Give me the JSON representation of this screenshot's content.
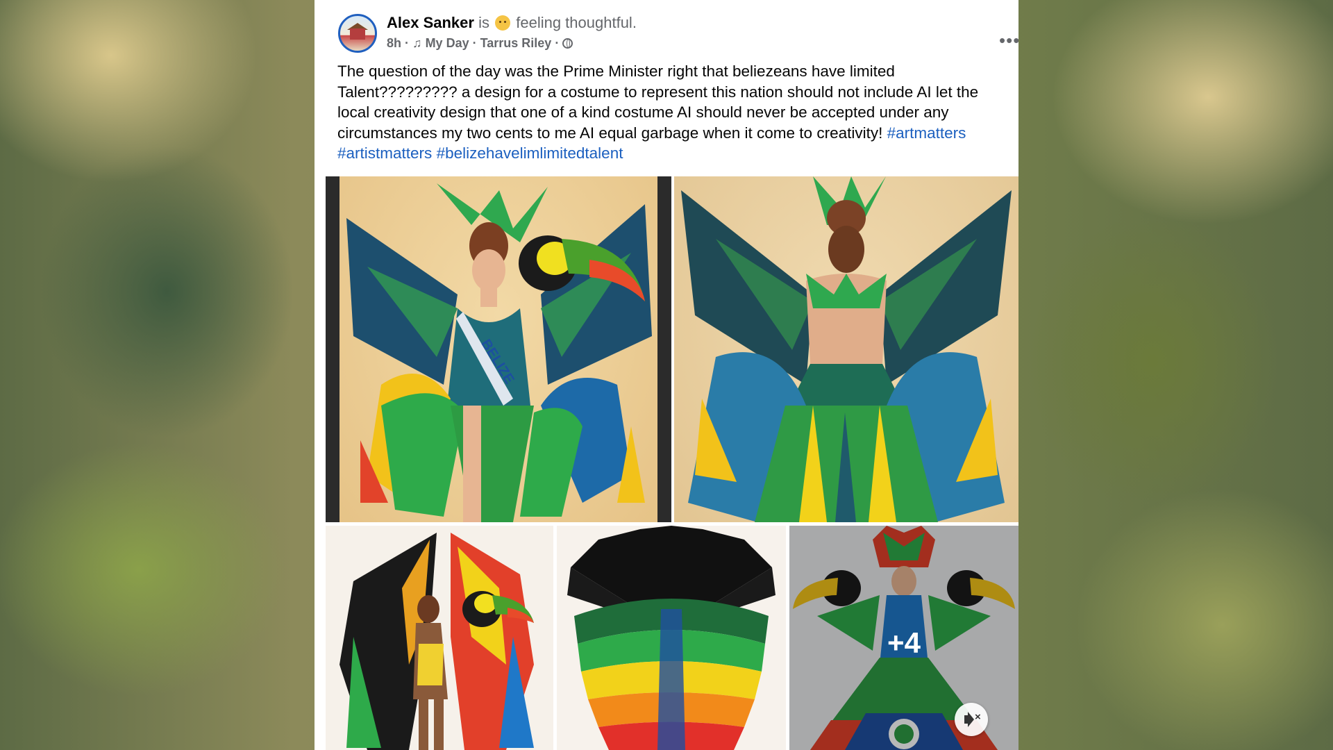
{
  "post": {
    "author": "Alex Sanker",
    "activity_prefix": "is",
    "feeling": "feeling thoughtful.",
    "time": "8h",
    "dot1": "·",
    "music": "My Day · Tarrus Riley",
    "dot2": "·",
    "more_label": "•••",
    "body": "The question of the day was the Prime Minister right that beliezeans have limited Talent????????? a design for a costume to represent this nation should not include AI let the local creativity design that one of a kind costume AI should never be accepted under any circumstances my two cents to me AI equal garbage when it come to creativity!",
    "hashtags": [
      "#artmatters",
      "#artistmatters",
      "#belizehavelimlimitedtalent"
    ]
  },
  "media": {
    "images": [
      {
        "subject": "toucan-winged costume front with BELIZE sash",
        "sash_text": "BELIZE"
      },
      {
        "subject": "toucan-winged costume back view"
      },
      {
        "subject": "rainbow feather costume with toucan"
      },
      {
        "subject": "rainbow feather fan"
      },
      {
        "subject": "toucan costume with floral headdress"
      }
    ],
    "more_count": "+4"
  },
  "colors": {
    "link": "#1b5fbf",
    "text": "#050505",
    "secondary": "#65676b",
    "avatar_ring": "#1f5fbf"
  },
  "icons": [
    "music-note-icon",
    "globe-icon",
    "more-icon",
    "mute-icon",
    "feeling-emoji-icon"
  ]
}
